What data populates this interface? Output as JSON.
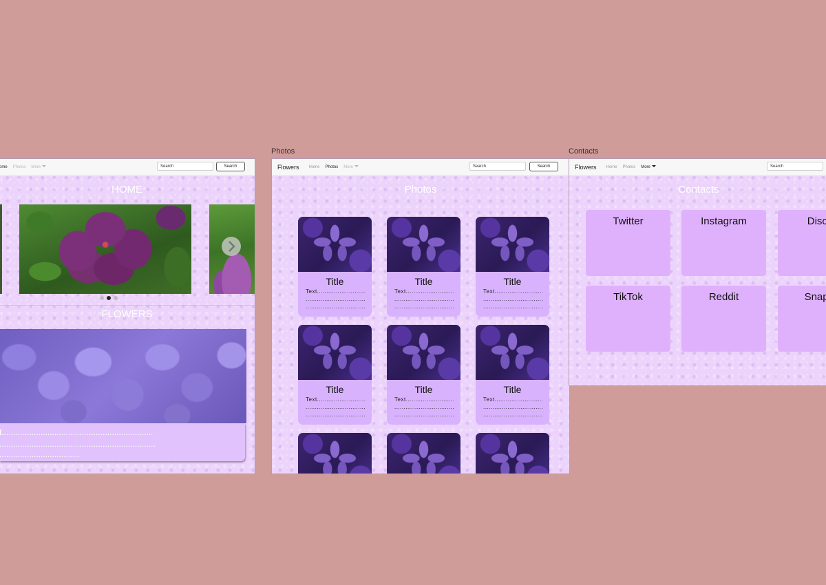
{
  "colors": {
    "canvas": "#cf9c9a",
    "page_bg": "#ecd3fb",
    "card_bg": "#d8b2fd",
    "contact_card_bg": "#dfb1fd",
    "heading_text": "#ffffff"
  },
  "frames": {
    "home": {
      "nav": {
        "links": [
          "ome",
          "Photos",
          "More"
        ],
        "search_placeholder": "Search",
        "search_button": "Search"
      },
      "heading": "HOME",
      "carousel": {
        "next_icon": "chevron-right-icon",
        "active_dot": 2,
        "dot_count": 3
      },
      "section_heading": "FLOWERS",
      "text_block": {
        "line1": "t..................................................................",
        "line2": "....................................................................",
        "line3": "..................................."
      }
    },
    "photos": {
      "label": "Photos",
      "nav": {
        "brand": "Flowers",
        "links": [
          "Home",
          "Photos",
          "More"
        ],
        "active": "Photos",
        "search_placeholder": "Search",
        "search_button": "Search"
      },
      "heading": "Photos",
      "card": {
        "title": "Title",
        "line1": "Text..........................",
        "line2": ".................................",
        "line3": "................................."
      }
    },
    "contacts": {
      "label": "Contacts",
      "nav": {
        "brand": "Flowers",
        "links": [
          "Home",
          "Photos",
          "More"
        ],
        "active": "More",
        "search_placeholder": "Search"
      },
      "heading": "Contacts",
      "cards": [
        "Twitter",
        "Instagram",
        "Disco",
        "TikTok",
        "Reddit",
        "SnapC"
      ]
    }
  }
}
